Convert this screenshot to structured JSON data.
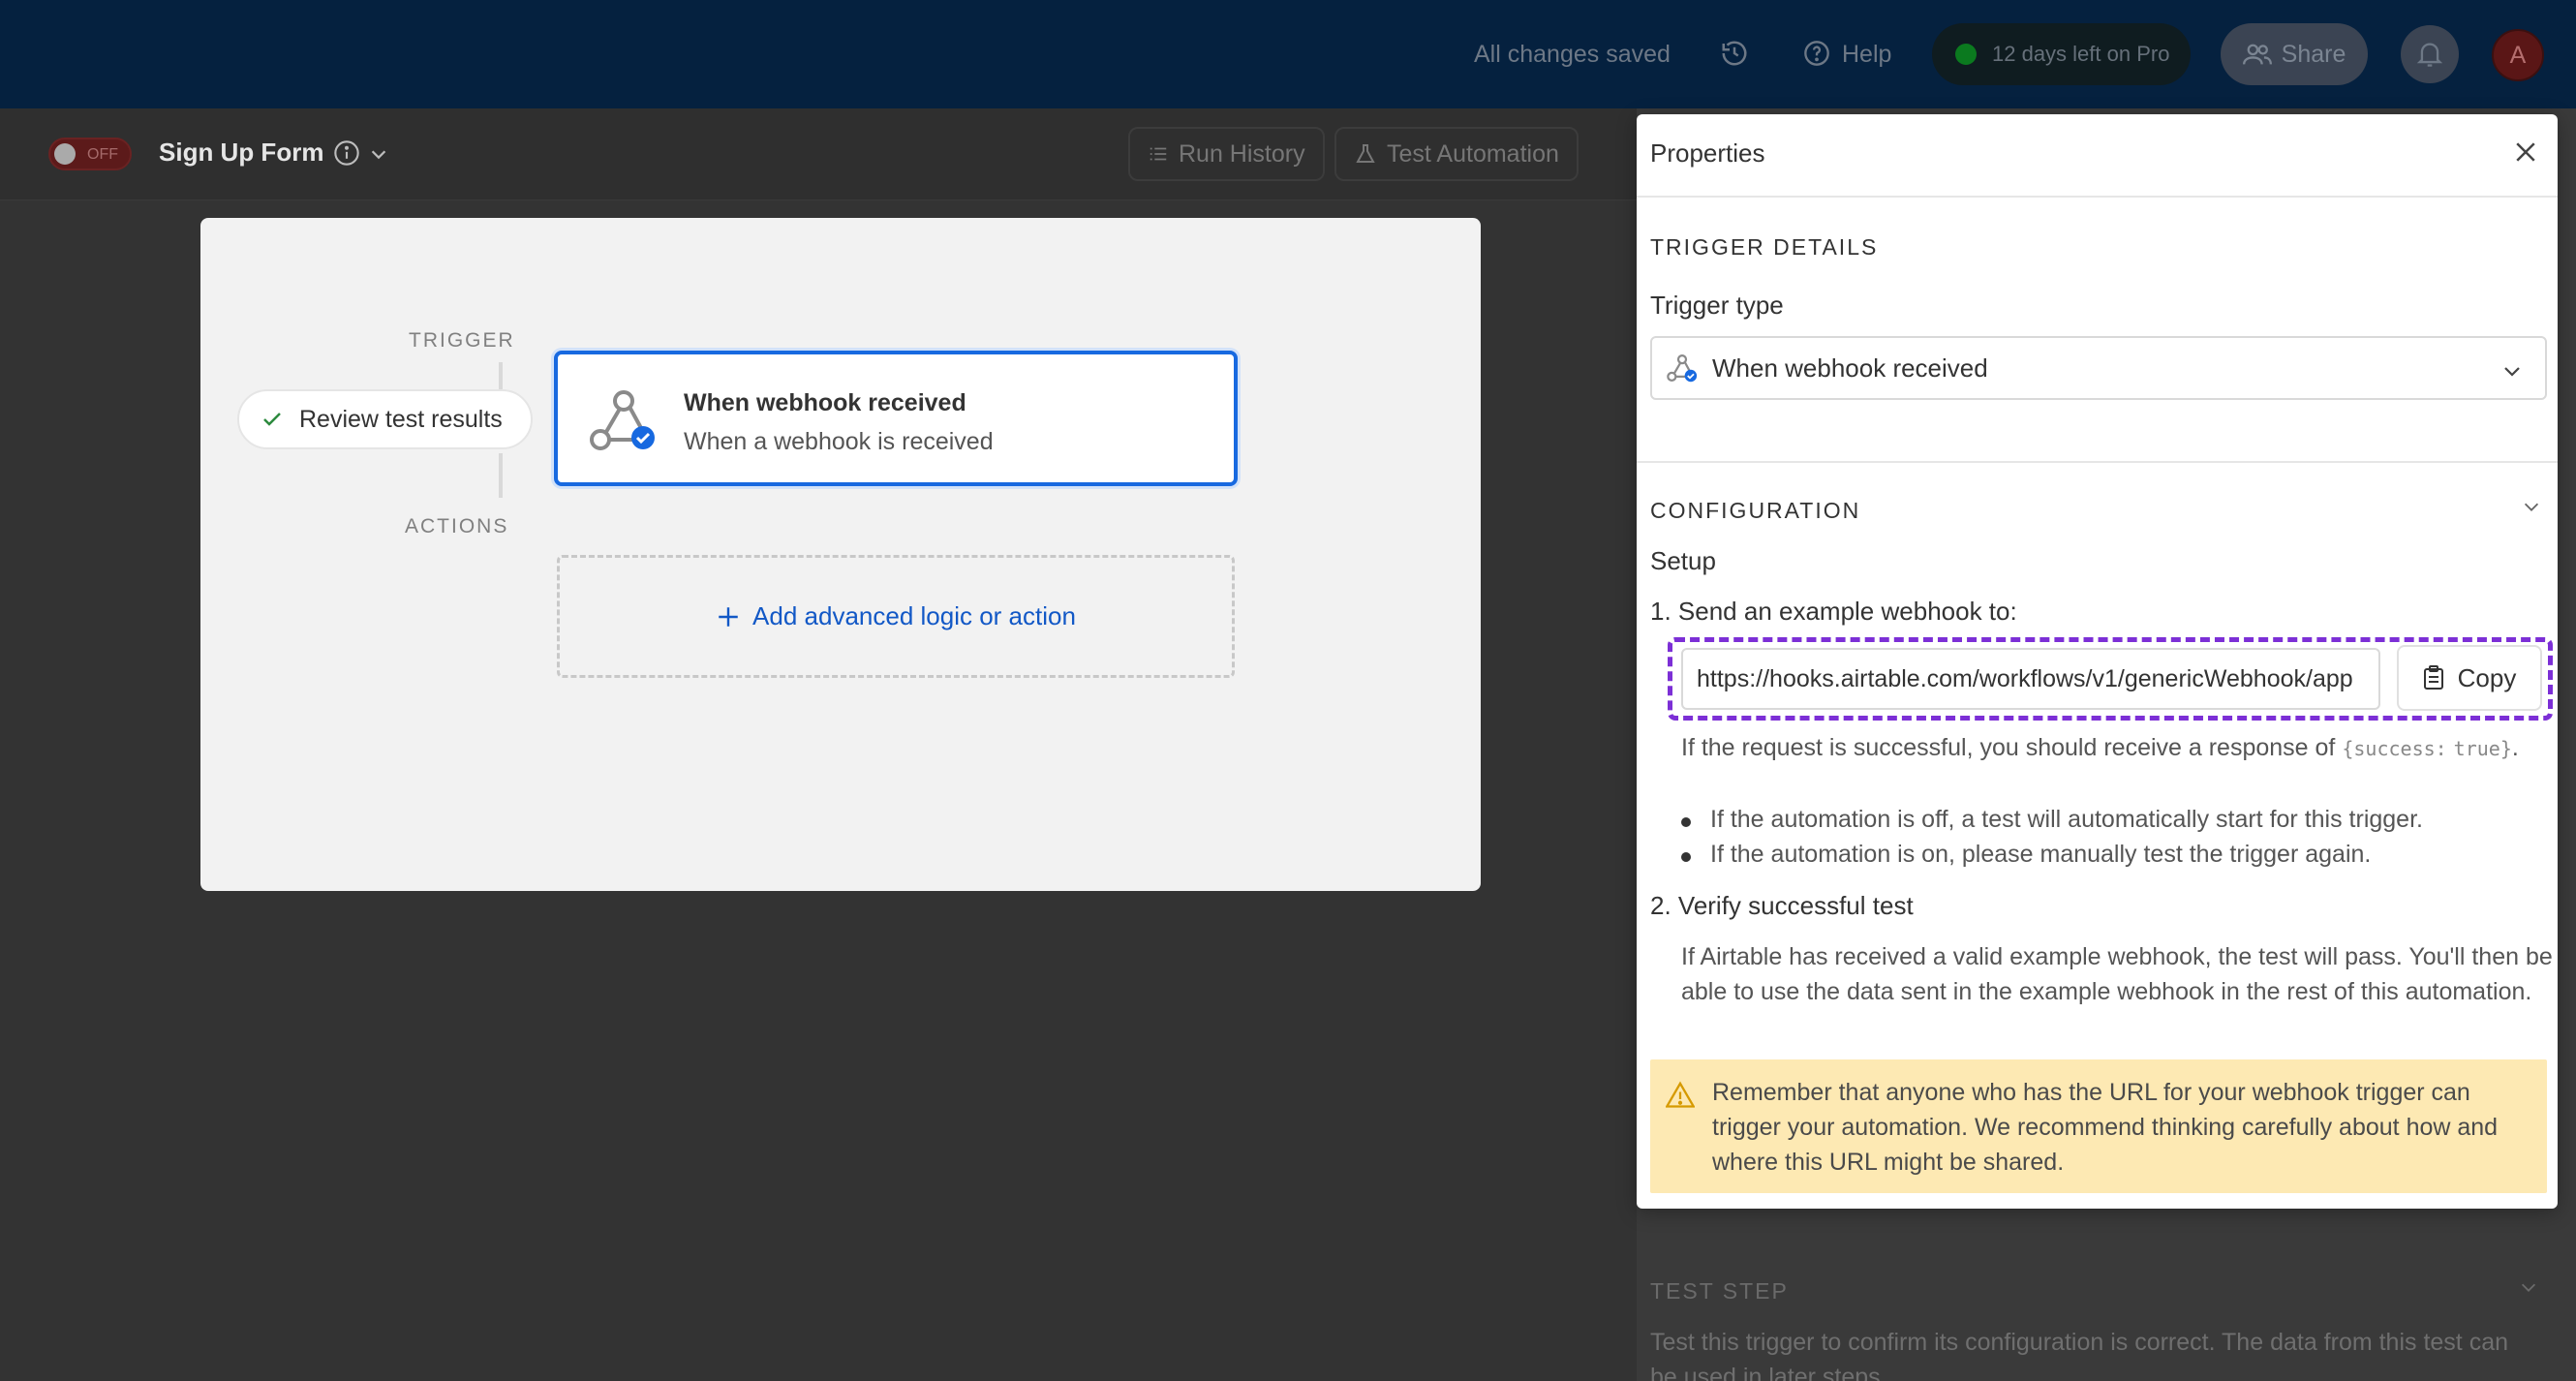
{
  "topbar": {
    "status": "All changes saved",
    "help": "Help",
    "trial": "12 days left on Pro",
    "share": "Share",
    "avatar_initial": "A"
  },
  "subbar": {
    "toggle_label": "OFF",
    "automation_name": "Sign Up Form",
    "run_history": "Run History",
    "test_automation": "Test Automation"
  },
  "canvas": {
    "trigger_label": "TRIGGER",
    "actions_label": "ACTIONS",
    "review_button": "Review test results",
    "trigger_card_title": "When webhook received",
    "trigger_card_subtitle": "When a webhook is received",
    "add_action": "Add advanced logic or action"
  },
  "panel": {
    "title": "Properties",
    "trigger_details_heading": "TRIGGER DETAILS",
    "trigger_type_label": "Trigger type",
    "trigger_type_value": "When webhook received",
    "configuration_heading": "CONFIGURATION",
    "setup_label": "Setup",
    "step1_label": "1. Send an example webhook to:",
    "webhook_url": "https://hooks.airtable.com/workflows/v1/genericWebhook/app",
    "copy_button": "Copy",
    "response_text": "If the request is successful, you should receive a response of",
    "response_code_1": "{success:",
    "response_code_2": "true}",
    "response_end": ".",
    "bullet_1": "If the automation is off, a test will automatically start for this trigger.",
    "bullet_2": "If the automation is on, please manually test the trigger again.",
    "step2_label": "2. Verify successful test",
    "step2_text": "If Airtable has received a valid example webhook, the test will pass. You'll then be able to use the data sent in the example webhook in the rest of this automation.",
    "warning_text": "Remember that anyone who has the URL for your webhook trigger can trigger your automation. We recommend thinking carefully about how and where this URL might be shared."
  },
  "side_background": {
    "test_step_heading": "TEST STEP",
    "test_step_text": "Test this trigger to confirm its configuration is correct. The data from this test can be used in later steps."
  },
  "colors": {
    "topbar": "#05213f",
    "accent_blue": "#1769e0",
    "highlight_purple": "#7c2fd6",
    "warning_bg": "#fde9b3"
  }
}
